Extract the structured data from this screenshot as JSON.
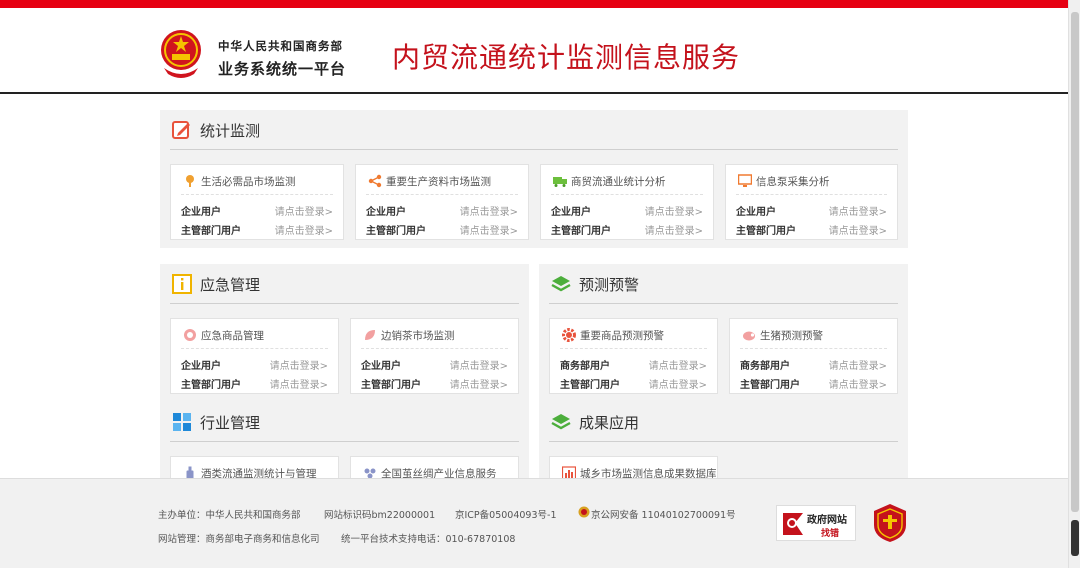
{
  "header": {
    "org_line1": "中华人民共和国商务部",
    "org_line2": "业务系统统一平台",
    "site_title": "内贸流通统计监测信息服务"
  },
  "colors": {
    "brand_red": "#e60012",
    "title_red": "#c4121c",
    "panel_bg": "#f2f2f2"
  },
  "sections": {
    "stats": {
      "title": "统计监测",
      "icon": "edit-note-icon",
      "cards": [
        {
          "title": "生活必需品市场监测",
          "icon": "location-pin-icon",
          "rows": [
            {
              "label": "企业用户",
              "action": "请点击登录>"
            },
            {
              "label": "主管部门用户",
              "action": "请点击登录>"
            }
          ]
        },
        {
          "title": "重要生产资料市场监测",
          "icon": "share-nodes-icon",
          "rows": [
            {
              "label": "企业用户",
              "action": "请点击登录>"
            },
            {
              "label": "主管部门用户",
              "action": "请点击登录>"
            }
          ]
        },
        {
          "title": "商贸流通业统计分析",
          "icon": "truck-icon",
          "rows": [
            {
              "label": "企业用户",
              "action": "请点击登录>"
            },
            {
              "label": "主管部门用户",
              "action": "请点击登录>"
            }
          ]
        },
        {
          "title": "信息泵采集分析",
          "icon": "monitor-icon",
          "rows": [
            {
              "label": "企业用户",
              "action": "请点击登录>"
            },
            {
              "label": "主管部门用户",
              "action": "请点击登录>"
            }
          ]
        }
      ]
    },
    "emergency": {
      "title": "应急管理",
      "icon": "info-box-icon",
      "cards": [
        {
          "title": "应急商品管理",
          "icon": "shield-circle-icon",
          "rows": [
            {
              "label": "企业用户",
              "action": "请点击登录>"
            },
            {
              "label": "主管部门用户",
              "action": "请点击登录>"
            }
          ]
        },
        {
          "title": "边销茶市场监测",
          "icon": "tea-leaf-icon",
          "rows": [
            {
              "label": "企业用户",
              "action": "请点击登录>"
            },
            {
              "label": "主管部门用户",
              "action": "请点击登录>"
            }
          ]
        }
      ]
    },
    "warning": {
      "title": "预测预警",
      "icon": "layers-icon",
      "cards": [
        {
          "title": "重要商品预测预警",
          "icon": "gear-icon",
          "rows": [
            {
              "label": "商务部用户",
              "action": "请点击登录>"
            },
            {
              "label": "主管部门用户",
              "action": "请点击登录>"
            }
          ]
        },
        {
          "title": "生猪预测预警",
          "icon": "pig-icon",
          "rows": [
            {
              "label": "商务部用户",
              "action": "请点击登录>"
            },
            {
              "label": "主管部门用户",
              "action": "请点击登录>"
            }
          ]
        }
      ]
    },
    "industry": {
      "title": "行业管理",
      "icon": "grid-icon",
      "cards": [
        {
          "title": "酒类流通监测统计与管理",
          "icon": "bottle-icon"
        },
        {
          "title": "全国茧丝绸产业信息服务",
          "icon": "people-icon"
        }
      ]
    },
    "results": {
      "title": "成果应用",
      "icon": "layers-icon",
      "cards": [
        {
          "title": "城乡市场监测信息成果数据库",
          "icon": "bar-chart-icon"
        }
      ]
    }
  },
  "footer": {
    "sponsor": "主办单位：中华人民共和国商务部",
    "site_id": "网站标识码bm22000001",
    "icp": "京ICP备05004093号-1",
    "police": "京公网安备 11040102700091号",
    "manager": "网站管理：商务部电子商务和信息化司",
    "support": "统一平台技术支持电话：010-67870108",
    "badge_gov": "政府网站",
    "badge_gov_sub": "找错"
  }
}
